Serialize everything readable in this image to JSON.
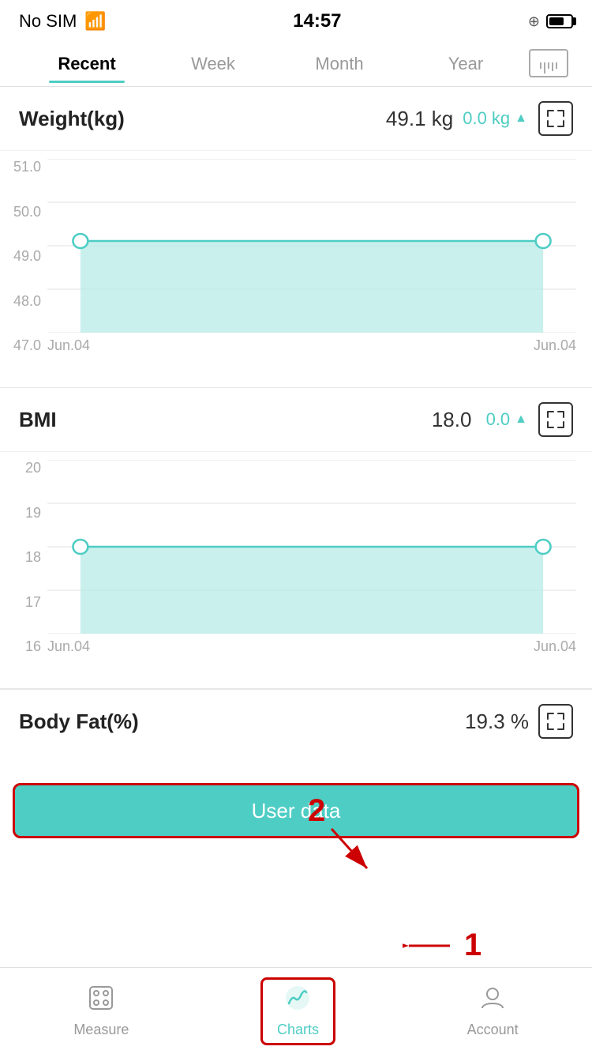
{
  "status": {
    "carrier": "No SIM",
    "time": "14:57"
  },
  "tabs": {
    "items": [
      {
        "label": "Recent",
        "active": true
      },
      {
        "label": "Week",
        "active": false
      },
      {
        "label": "Month",
        "active": false
      },
      {
        "label": "Year",
        "active": false
      }
    ]
  },
  "weight_section": {
    "title": "Weight(kg)",
    "value": "49.1 kg",
    "change": "0.0 kg",
    "direction": "▲",
    "y_labels": [
      "51.0",
      "50.0",
      "49.0",
      "48.0",
      "47.0"
    ],
    "x_labels": [
      "Jun.04",
      "Jun.04"
    ],
    "data_start": 49.1,
    "data_end": 49.1,
    "y_min": 47.0,
    "y_max": 51.0
  },
  "bmi_section": {
    "title": "BMI",
    "value": "18.0",
    "change": "0.0",
    "direction": "▲",
    "y_labels": [
      "20",
      "19",
      "18",
      "17",
      "16"
    ],
    "x_labels": [
      "Jun.04",
      "Jun.04"
    ],
    "data_start": 18.0,
    "data_end": 18.0,
    "y_min": 16,
    "y_max": 20
  },
  "partial_section": {
    "title": "Body Fat(%)",
    "value": "19.3 %"
  },
  "user_data_btn": {
    "label": "User data"
  },
  "bottom_nav": {
    "items": [
      {
        "label": "Measure",
        "icon": "measure",
        "active": false
      },
      {
        "label": "Charts",
        "icon": "charts",
        "active": true
      },
      {
        "label": "Account",
        "icon": "account",
        "active": false
      }
    ]
  },
  "annotations": {
    "arrow1_label": "1",
    "arrow2_label": "2"
  }
}
